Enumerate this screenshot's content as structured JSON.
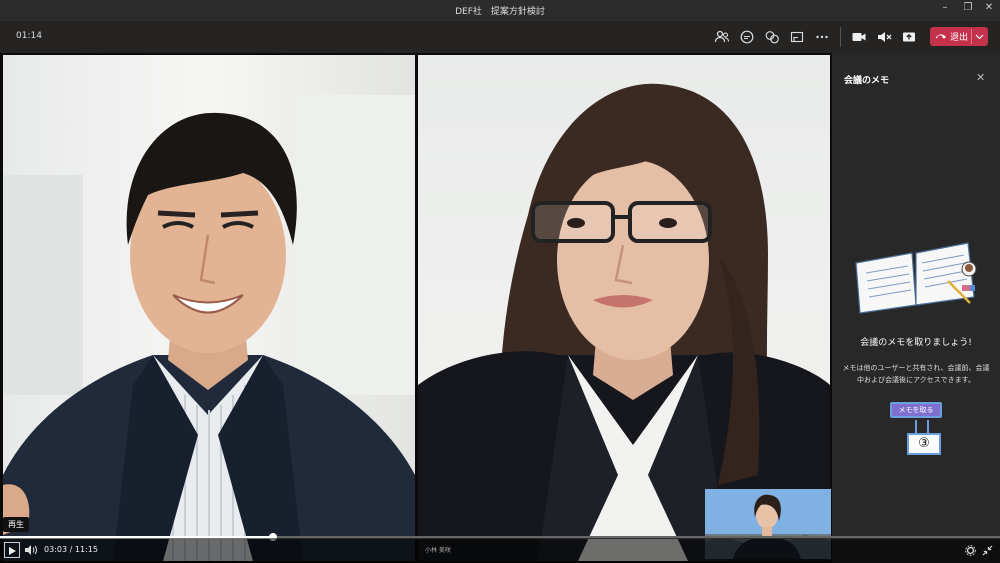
{
  "window": {
    "title": "DEF社　提案方針検討",
    "controls": [
      "minimize-icon",
      "restore-icon",
      "close-icon"
    ]
  },
  "toolbar": {
    "timer": "01:14",
    "icons": [
      "participants-icon",
      "chat-icon",
      "reactions-icon",
      "share-tray-icon",
      "more-icon",
      "camera-icon",
      "mute-icon",
      "share-icon"
    ],
    "leave_label": "退出"
  },
  "panel": {
    "title": "会議のメモ",
    "heading": "会議のメモを取りましょう!",
    "description": "メモは他のユーザーと共有され、会議前、会議中および会議後にアクセスできます。",
    "button_label": "メモを取る",
    "callout_number": "③"
  },
  "playback": {
    "tooltip": "再生",
    "current_time": "03:03",
    "separator": "/",
    "total_time": "11:15",
    "progress_fraction": 0.273,
    "participant_label": "小林 美咲"
  },
  "colors": {
    "leave": "#c4314b",
    "accent": "#7f6fcf",
    "highlight": "#6aa0e0"
  }
}
